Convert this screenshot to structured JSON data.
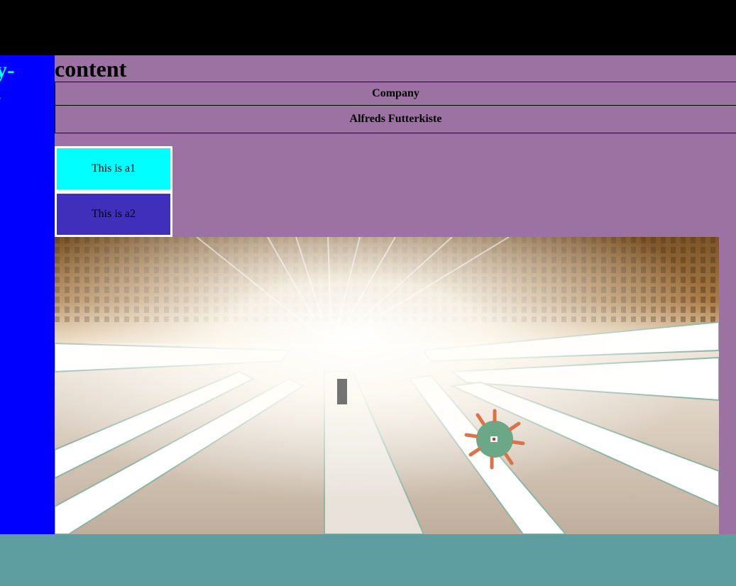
{
  "sidebar": {
    "title": "y-\n."
  },
  "main": {
    "title": "content",
    "table": {
      "header": "Company",
      "rows": [
        "Alfreds Futterkiste"
      ]
    },
    "boxes": {
      "a1": "This is a1",
      "a2": "This is a2"
    },
    "image_subject": "voxel-game-hall-with-glowing-light-panels"
  },
  "colors": {
    "header_band": "#000000",
    "sidebar_bg": "#0000ff",
    "sidebar_text": "#00ffff",
    "main_bg": "#9b72a2",
    "box_a1_bg": "#00ffff",
    "box_a2_bg": "#3f2fba",
    "footer_bg": "#5f9ea0"
  }
}
